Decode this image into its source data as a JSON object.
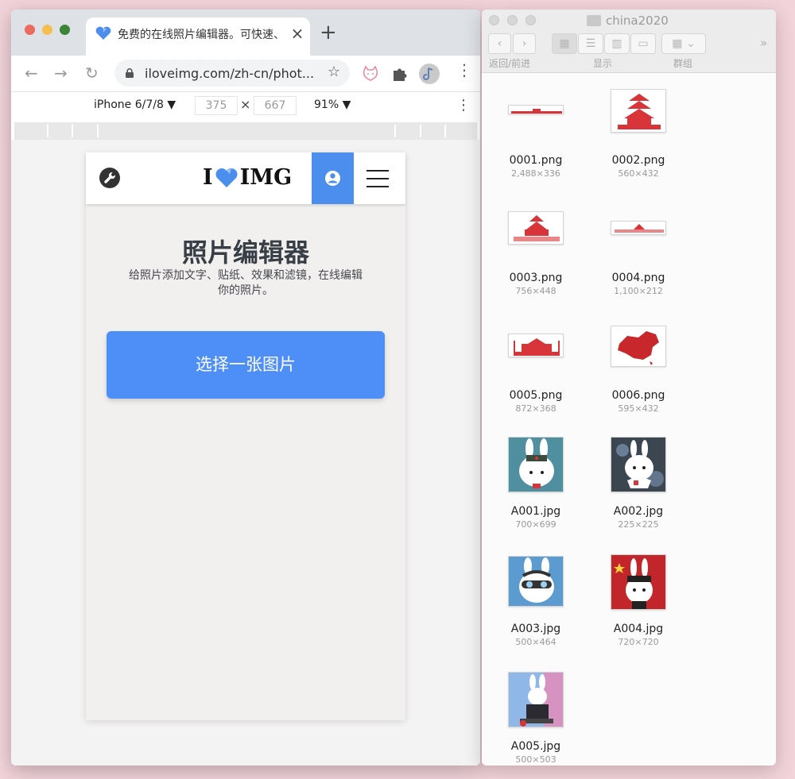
{
  "browser": {
    "tab_title": "免费的在线照片编辑器。可快速、",
    "tab_close": "×",
    "new_tab": "+",
    "url": "iloveimg.com/zh-cn/phot...",
    "back": "←",
    "forward": "→",
    "reload": "↻",
    "star": "☆",
    "menu": "⋮",
    "device": "iPhone 6/7/8 ▼",
    "width": "375",
    "height": "667",
    "dims_x": "×",
    "zoom": "91% ▼",
    "dev_menu": "⋮"
  },
  "site": {
    "logo_left": "I",
    "logo_right": "IMG",
    "title": "照片编辑器",
    "description": "给照片添加文字、贴纸、效果和滤镜，在线编辑你的照片。",
    "select_button": "选择一张图片",
    "accent": "#4d8ff7"
  },
  "finder": {
    "title": "china2020",
    "back_forward_label": "返回/前进",
    "view_label": "显示",
    "group_label": "群组",
    "more": "»",
    "files": [
      {
        "name": "0001.png",
        "dims": "2,488×336"
      },
      {
        "name": "0002.png",
        "dims": "560×432"
      },
      {
        "name": "0003.png",
        "dims": "756×448"
      },
      {
        "name": "0004.png",
        "dims": "1,100×212"
      },
      {
        "name": "0005.png",
        "dims": "872×368"
      },
      {
        "name": "0006.png",
        "dims": "595×432"
      },
      {
        "name": "A001.jpg",
        "dims": "700×699"
      },
      {
        "name": "A002.jpg",
        "dims": "225×225"
      },
      {
        "name": "A003.jpg",
        "dims": "500×464"
      },
      {
        "name": "A004.jpg",
        "dims": "720×720"
      },
      {
        "name": "A005.jpg",
        "dims": "500×503"
      }
    ]
  }
}
